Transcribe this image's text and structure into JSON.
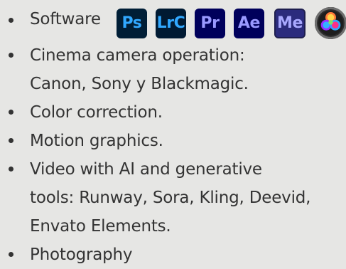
{
  "skills": {
    "software_label": "Software",
    "software_icons": {
      "photoshop": {
        "text": "Ps",
        "name": "photoshop-icon"
      },
      "lightroom_classic": {
        "text": "LrC",
        "name": "lightroom-classic-icon"
      },
      "premiere_pro": {
        "text": "Pr",
        "name": "premiere-pro-icon"
      },
      "after_effects": {
        "text": "Ae",
        "name": "after-effects-icon"
      },
      "media_encoder": {
        "text": "Me",
        "name": "media-encoder-icon"
      },
      "davinci_resolve": {
        "name": "davinci-resolve-icon"
      }
    },
    "items": [
      {
        "lines": [
          "Cinema camera operation:",
          "Canon, Sony y Blackmagic."
        ]
      },
      {
        "text": "Color correction."
      },
      {
        "text": "Motion graphics."
      },
      {
        "lines": [
          "Video with AI and generative",
          "tools: Runway, Sora, Kling, Deevid,",
          "Envato Elements."
        ]
      },
      {
        "text": "Photography"
      }
    ]
  },
  "colors": {
    "background": "#e6e6e4",
    "text": "#333333",
    "photoshop_bg": "#001e36",
    "photoshop_fg": "#31a8ff",
    "premiere_bg": "#00005b",
    "premiere_fg": "#9999ff"
  }
}
